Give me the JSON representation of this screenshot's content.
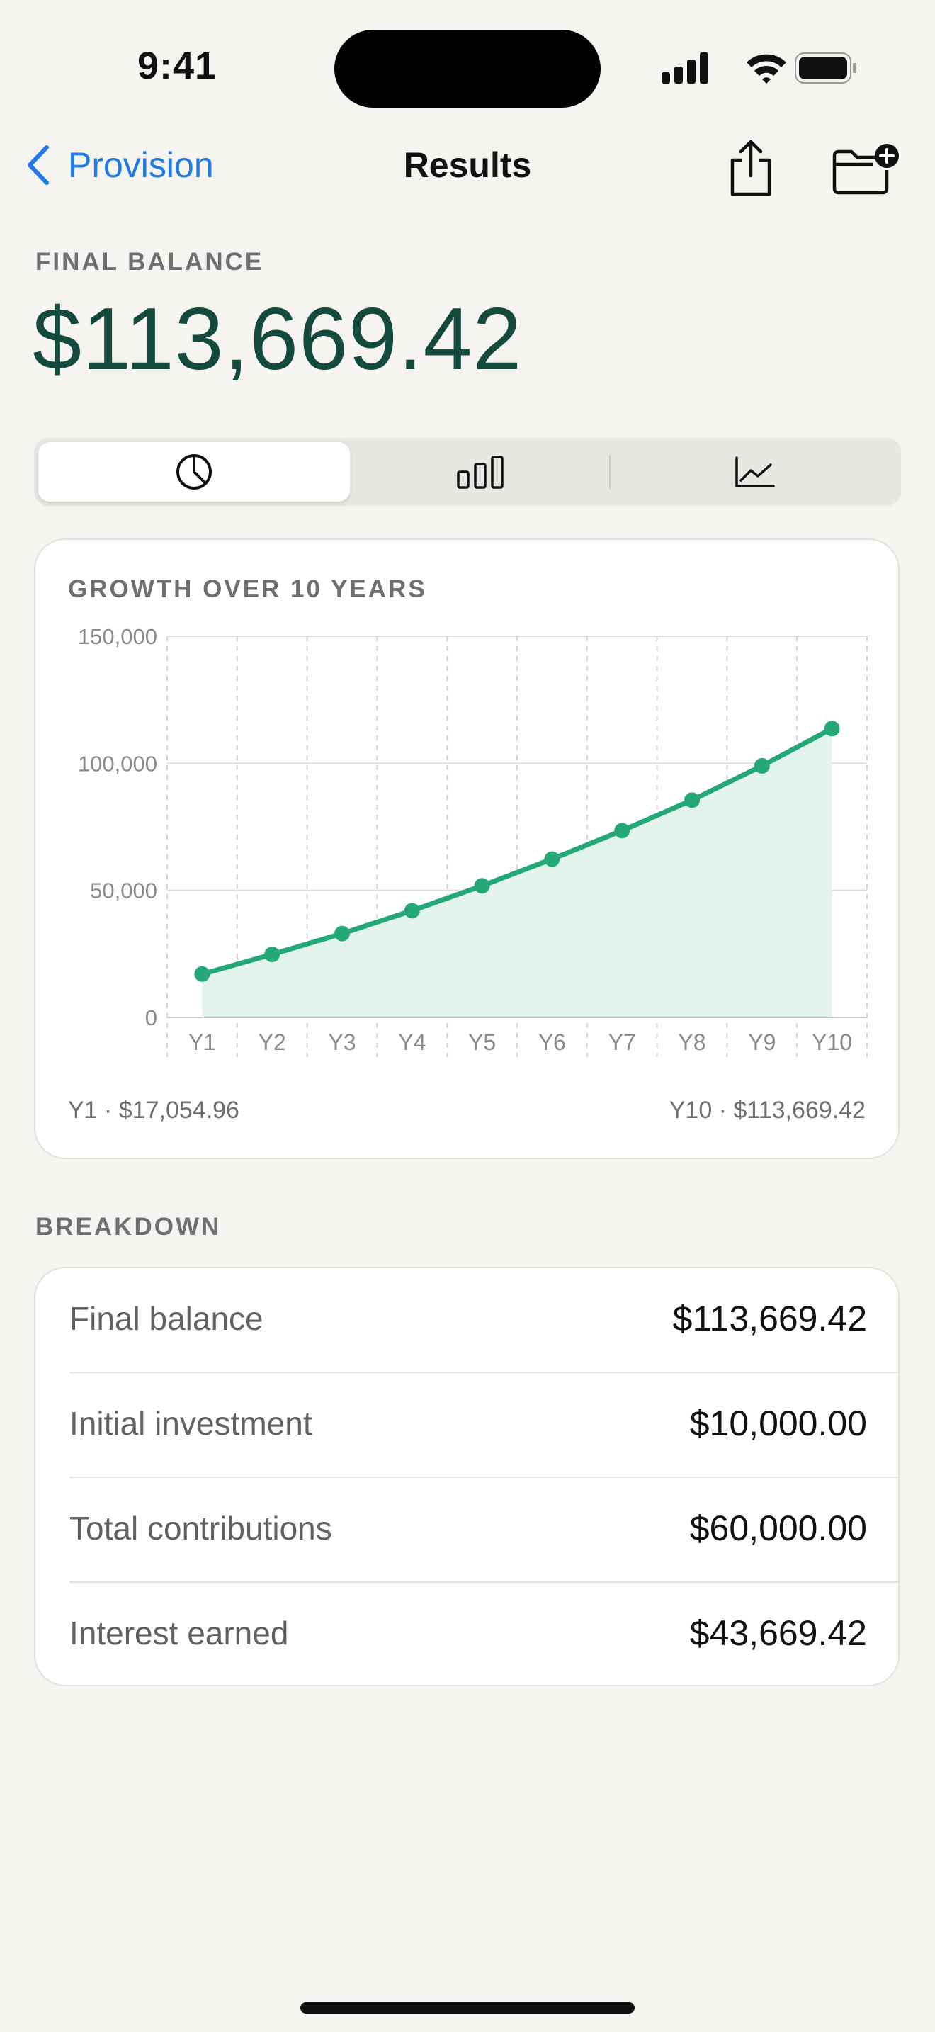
{
  "status_bar": {
    "time": "9:41"
  },
  "nav": {
    "back_label": "Provision",
    "title": "Results"
  },
  "summary": {
    "label": "FINAL BALANCE",
    "value": "$113,669.42"
  },
  "segmented": {
    "selected": 0,
    "icons": [
      "pie-chart-icon",
      "bar-chart-icon",
      "line-chart-icon"
    ]
  },
  "chart": {
    "title": "GROWTH OVER 10 YEARS",
    "first_label": "Y1 · $17,054.96",
    "last_label": "Y10 · $113,669.42"
  },
  "chart_data": {
    "type": "area",
    "title": "GROWTH OVER 10 YEARS",
    "categories": [
      "Y1",
      "Y2",
      "Y3",
      "Y4",
      "Y5",
      "Y6",
      "Y7",
      "Y8",
      "Y9",
      "Y10"
    ],
    "values": [
      17054.96,
      24800,
      33000,
      42000,
      51800,
      62300,
      73500,
      85500,
      99000,
      113669.42
    ],
    "ylim": [
      0,
      150000
    ],
    "yticks": [
      0,
      50000,
      100000,
      150000
    ],
    "ytick_labels": [
      "0",
      "50,000",
      "100,000",
      "150,000"
    ],
    "grid": true,
    "line_color": "#24a878",
    "fill_color": "#e2f4ec"
  },
  "breakdown": {
    "title": "BREAKDOWN",
    "rows": [
      {
        "label": "Final balance",
        "value": "$113,669.42"
      },
      {
        "label": "Initial investment",
        "value": "$10,000.00"
      },
      {
        "label": "Total contributions",
        "value": "$60,000.00"
      },
      {
        "label": "Interest earned",
        "value": "$43,669.42"
      }
    ]
  },
  "colors": {
    "accent": "#1f7ae6",
    "balance": "#144a3e",
    "chart_green": "#24a878"
  }
}
